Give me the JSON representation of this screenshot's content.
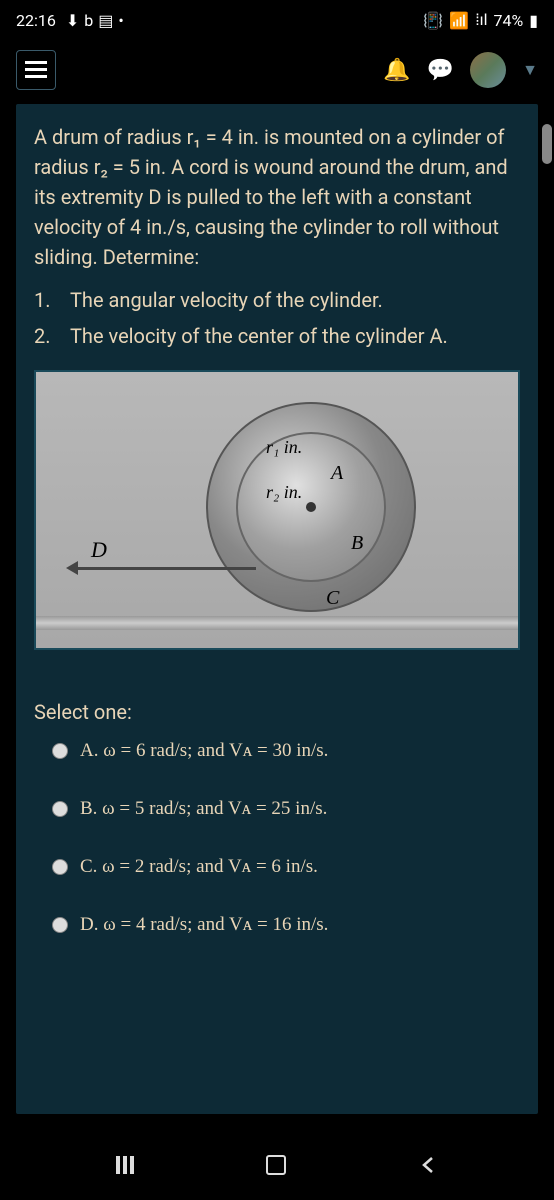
{
  "status": {
    "time": "22:16",
    "battery": "74%"
  },
  "problem": {
    "text": "A drum of radius r₁ = 4 in. is mounted on a cylinder of radius r₂ = 5 in. A cord is wound around the drum, and its extremity D is pulled to the left with a constant velocity of 4 in./s, causing the cylinder to roll without sliding. Determine:",
    "items": [
      {
        "num": "1.",
        "text": "The angular velocity of the cylinder."
      },
      {
        "num": "2.",
        "text": "The velocity of the center of the cylinder A."
      }
    ]
  },
  "diagram": {
    "r1": "r₁ in.",
    "r2": "r₂ in.",
    "A": "A",
    "B": "B",
    "C": "C",
    "D": "D"
  },
  "select_label": "Select one:",
  "options": {
    "a": "A. ω = 6 rad/s; and Vᴀ = 30 in/s.",
    "b": "B. ω = 5 rad/s; and Vᴀ = 25 in/s.",
    "c": "C. ω = 2 rad/s; and Vᴀ = 6 in/s.",
    "d": "D. ω = 4 rad/s; and Vᴀ = 16 in/s."
  }
}
